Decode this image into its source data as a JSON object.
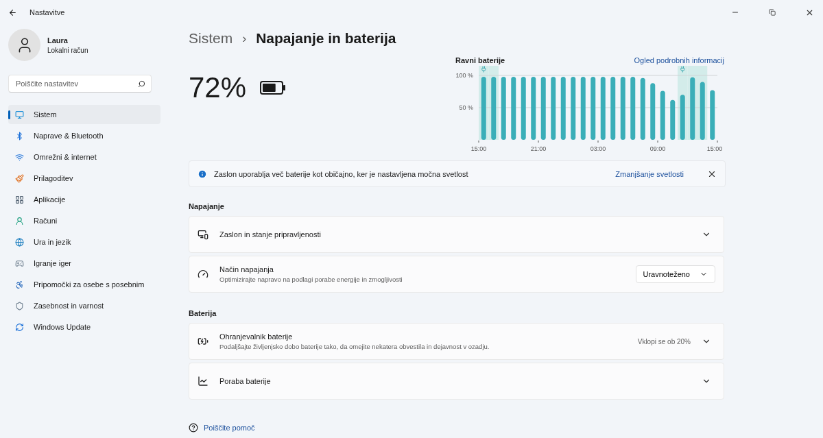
{
  "window": {
    "title": "Nastavitve"
  },
  "user": {
    "name": "Laura",
    "account": "Lokalni račun"
  },
  "search": {
    "placeholder": "Poiščite nastavitev"
  },
  "sidebar": {
    "items": [
      {
        "label": "Sistem",
        "selected": true
      },
      {
        "label": "Naprave & Bluetooth",
        "selected": false
      },
      {
        "label": "Omrežni & internet",
        "selected": false
      },
      {
        "label": "Prilagoditev",
        "selected": false
      },
      {
        "label": "Aplikacije",
        "selected": false
      },
      {
        "label": "Računi",
        "selected": false
      },
      {
        "label": "Ura in jezik",
        "selected": false
      },
      {
        "label": "Igranje iger",
        "selected": false
      },
      {
        "label": "Pripomočki za osebe s posebnim",
        "selected": false
      },
      {
        "label": "Zasebnost in varnost",
        "selected": false
      },
      {
        "label": "Windows Update",
        "selected": false
      }
    ]
  },
  "breadcrumb": {
    "parent": "Sistem",
    "separator": "›",
    "current": "Napajanje in baterija"
  },
  "battery": {
    "percent": "72%",
    "level": 0.72
  },
  "battery_chart": {
    "title": "Ravni baterije",
    "link": "Ogled podrobnih informacij",
    "chart_data": {
      "type": "bar",
      "categories": [
        "15:00",
        null,
        null,
        null,
        null,
        null,
        "21:00",
        null,
        null,
        null,
        null,
        null,
        "03:00",
        null,
        null,
        null,
        null,
        null,
        "09:00",
        null,
        null,
        null,
        null,
        null,
        "15:00"
      ],
      "series": [
        {
          "color": "#3aaeb8",
          "values": [
            98,
            98,
            98,
            98,
            98,
            98,
            98,
            98,
            98,
            98,
            98,
            98,
            98,
            98,
            98,
            98,
            96,
            88,
            76,
            62,
            70,
            97,
            90,
            77,
            null
          ]
        }
      ],
      "yticks": [
        {
          "value": 50,
          "label": "50 %"
        },
        {
          "value": 100,
          "label": "100 %"
        }
      ],
      "ylim": [
        0,
        100
      ]
    },
    "hours": [
      {
        "charging": true
      },
      {
        "charging": true
      },
      {
        "charging": false
      },
      {
        "charging": false
      },
      {
        "charging": false
      },
      {
        "charging": false
      },
      {
        "charging": false
      },
      {
        "charging": false
      },
      {
        "charging": false
      },
      {
        "charging": false
      },
      {
        "charging": false
      },
      {
        "charging": false
      },
      {
        "charging": false
      },
      {
        "charging": false
      },
      {
        "charging": false
      },
      {
        "charging": false
      },
      {
        "charging": false
      },
      {
        "charging": false
      },
      {
        "charging": false
      },
      {
        "charging": false
      },
      {
        "charging": true
      },
      {
        "charging": true
      },
      {
        "charging": true
      },
      {
        "charging": false
      }
    ]
  },
  "notice": {
    "text": "Zaslon uporablja več baterije kot običajno, ker je nastavljena močna svetlost",
    "action": "Zmanjšanje svetlosti"
  },
  "sections": [
    {
      "title": "Napajanje",
      "items": [
        {
          "kind": "expander",
          "title": "Zaslon in stanje pripravljenosti"
        },
        {
          "kind": "dropdown",
          "title": "Način napajanja",
          "description": "Optimizirajte napravo na podlagi porabe energije in zmogljivosti",
          "value": "Uravnoteženo"
        }
      ]
    },
    {
      "title": "Baterija",
      "items": [
        {
          "kind": "expander",
          "title": "Ohranjevalnik baterije",
          "description": "Podaljšajte življenjsko dobo baterije tako, da omejite nekatera obvestila in dejavnost v ozadju.",
          "status": "Vklopi se ob 20%"
        },
        {
          "kind": "expander",
          "title": "Poraba baterije"
        }
      ]
    }
  ],
  "help": {
    "label": "Poiščite pomoč"
  }
}
